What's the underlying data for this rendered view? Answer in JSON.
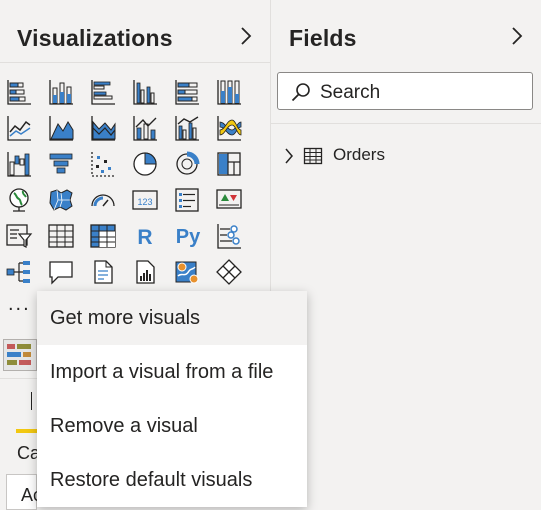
{
  "visualizations": {
    "title": "Visualizations",
    "icons": [
      "stacked-bar-chart-icon",
      "stacked-column-chart-icon",
      "clustered-bar-chart-icon",
      "clustered-column-chart-icon",
      "100-stacked-bar-chart-icon",
      "100-stacked-column-chart-icon",
      "line-chart-icon",
      "area-chart-icon",
      "stacked-area-chart-icon",
      "line-and-stacked-column-chart-icon",
      "line-and-clustered-column-chart-icon",
      "ribbon-chart-icon",
      "waterfall-chart-icon",
      "funnel-chart-icon",
      "scatter-chart-icon",
      "pie-chart-icon",
      "donut-chart-icon",
      "treemap-icon",
      "map-icon",
      "filled-map-icon",
      "gauge-icon",
      "card-icon",
      "multi-row-card-icon",
      "kpi-icon",
      "slicer-icon",
      "table-icon",
      "matrix-icon",
      "r-script-visual-icon",
      "python-visual-icon",
      "key-influencers-icon",
      "decomposition-tree-icon",
      "q-and-a-icon",
      "smart-narrative-icon",
      "paginated-report-icon",
      "arcgis-map-icon",
      "power-apps-icon"
    ],
    "r_label": "R",
    "py_label": "Py",
    "card_value": "123",
    "more": "...",
    "partial_labels": {
      "field": "Ca",
      "add": "Ac"
    }
  },
  "fields": {
    "title": "Fields",
    "search_placeholder": "Search",
    "tables": [
      {
        "name": "Orders"
      }
    ]
  },
  "context_menu": {
    "items": [
      "Get more visuals",
      "Import a visual from a file",
      "Remove a visual",
      "Restore default visuals"
    ]
  },
  "colors": {
    "accent": "#3a80c8",
    "highlight": "#f2c811",
    "menu_hover": "#f3f2f1"
  }
}
